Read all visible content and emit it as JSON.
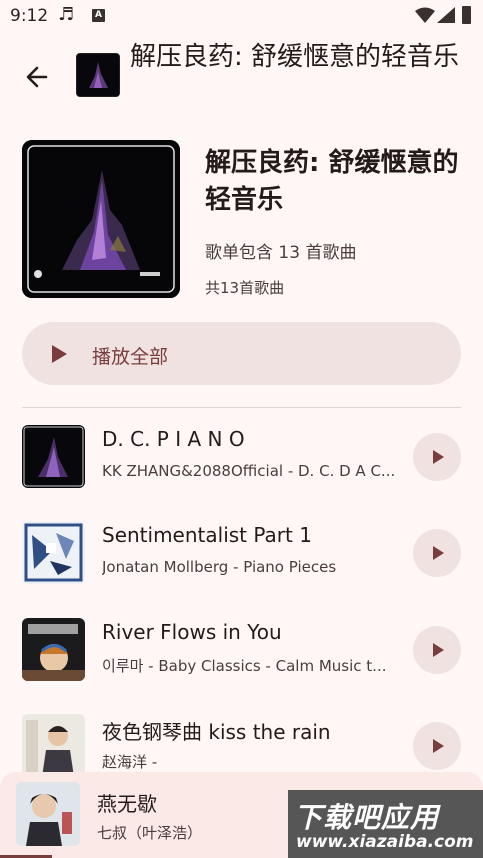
{
  "status_bar": {
    "time": "9:12"
  },
  "header": {
    "title": "解压良药: 舒缓惬意的轻音乐",
    "description": "歌单包含 13 首歌曲",
    "count": "共13首歌曲"
  },
  "play_all": {
    "label": "播放全部"
  },
  "tracks": [
    {
      "title": "D. C. P I A N O",
      "subtitle": "KK ZHANG&2088Official - D. C. D A C..."
    },
    {
      "title": "Sentimentalist Part 1",
      "subtitle": "Jonatan Mollberg - Piano Pieces"
    },
    {
      "title": "River Flows in You",
      "subtitle": "이루마 - Baby Classics - Calm Music t..."
    },
    {
      "title": "夜色钢琴曲 kiss the rain",
      "subtitle": "赵海洋 -"
    }
  ],
  "now_playing": {
    "title": "燕无歇",
    "artist": "七叔（叶泽浩）"
  },
  "watermark": {
    "line1": "下载吧应用",
    "line2": "www.xiazaiba.com"
  },
  "colors": {
    "accent": "#7a3d3e",
    "background": "#fff7f6",
    "chip": "#f0e2e1"
  }
}
